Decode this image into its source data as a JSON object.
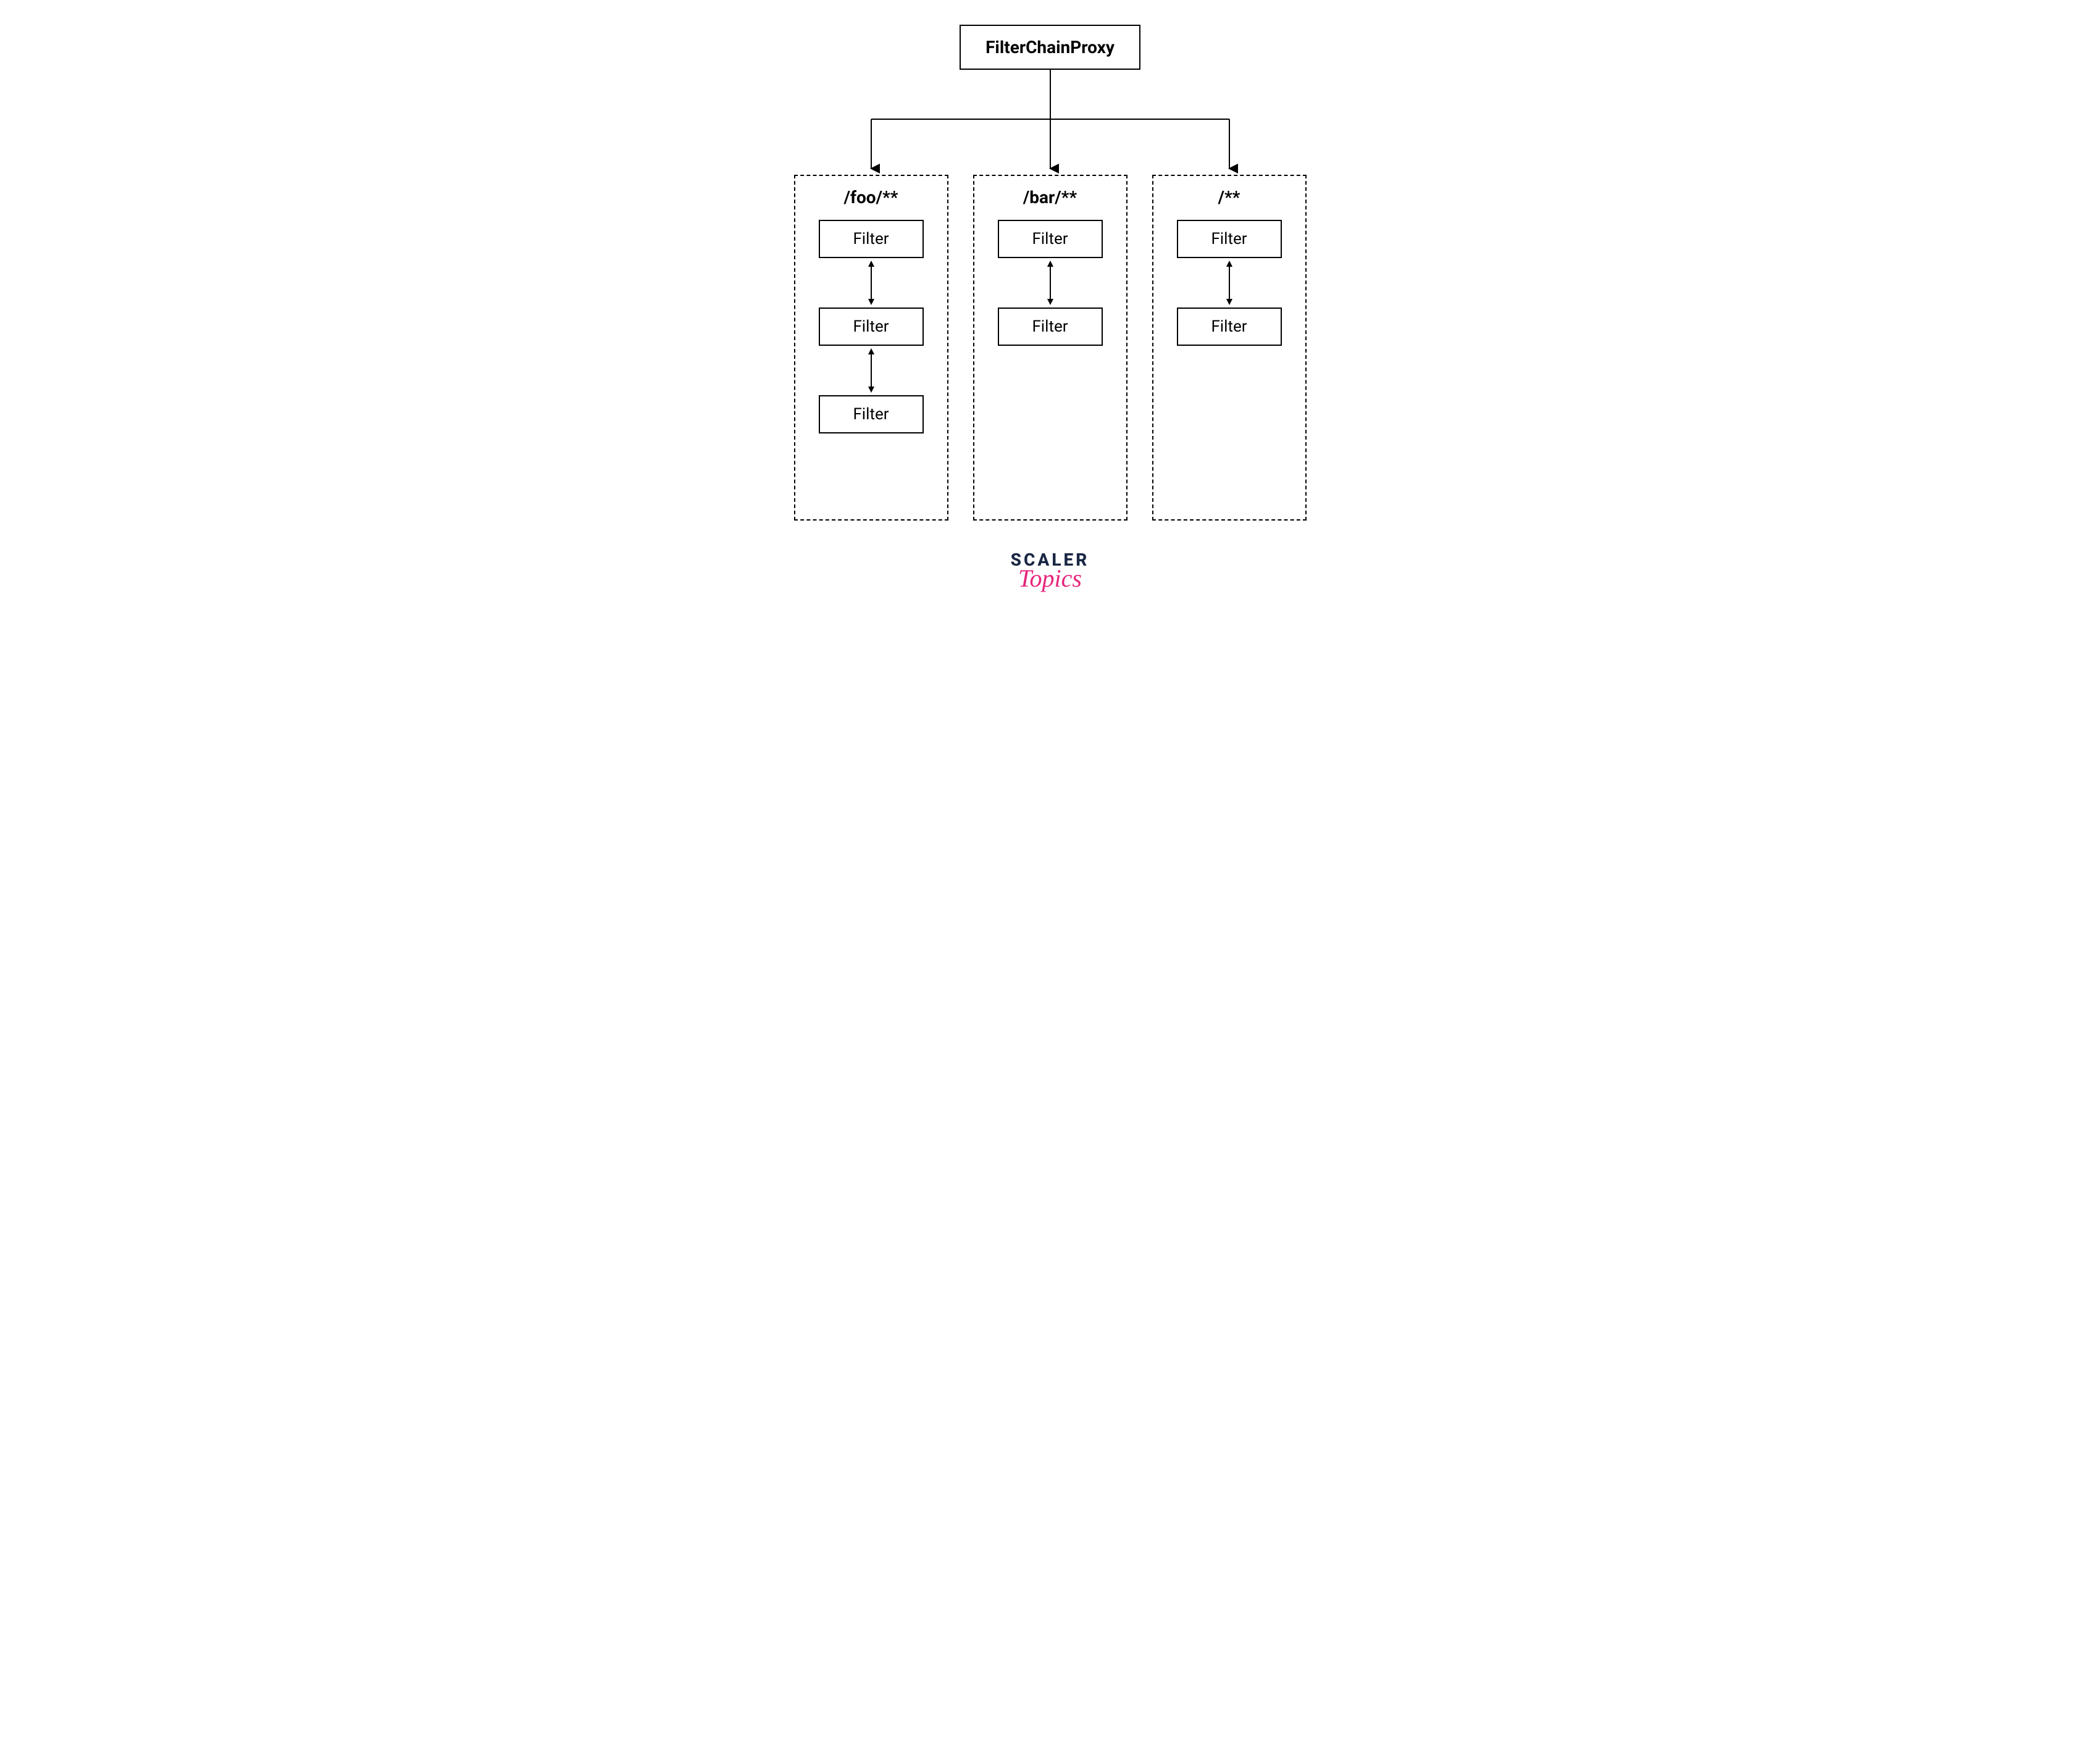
{
  "root": {
    "label": "FilterChainProxy"
  },
  "chains": [
    {
      "pattern": "/foo/**",
      "filters": [
        "Filter",
        "Filter",
        "Filter"
      ]
    },
    {
      "pattern": "/bar/**",
      "filters": [
        "Filter",
        "Filter"
      ]
    },
    {
      "pattern": "/**",
      "filters": [
        "Filter",
        "Filter"
      ]
    }
  ],
  "logo": {
    "top": "SCALER",
    "bottom": "Topics"
  }
}
